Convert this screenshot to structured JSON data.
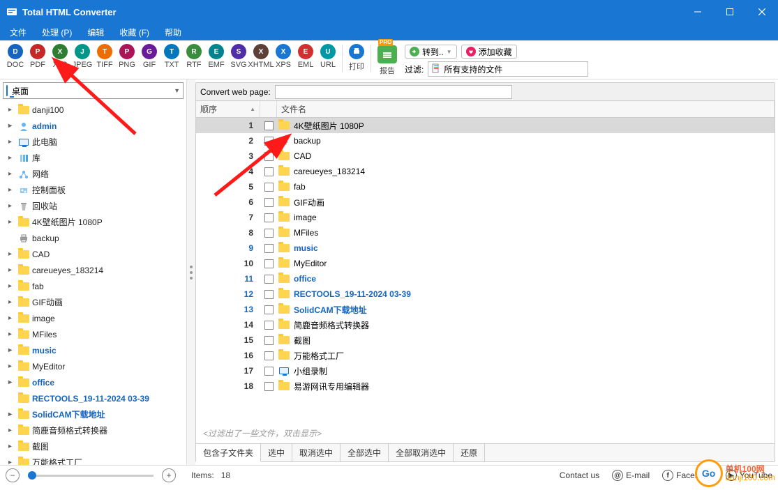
{
  "title": "Total HTML Converter",
  "menubar": [
    "文件",
    "处理 (P)",
    "编辑",
    "收藏 (F)",
    "帮助"
  ],
  "toolbar": {
    "formats": [
      {
        "label": "DOC",
        "color": "#1565C0"
      },
      {
        "label": "PDF",
        "color": "#C62828"
      },
      {
        "label": "XLS",
        "color": "#2E7D32"
      },
      {
        "label": "JPEG",
        "color": "#009688"
      },
      {
        "label": "TIFF",
        "color": "#EF6C00"
      },
      {
        "label": "PNG",
        "color": "#AD1457"
      },
      {
        "label": "GIF",
        "color": "#6A1B9A"
      },
      {
        "label": "TXT",
        "color": "#0277BD"
      },
      {
        "label": "RTF",
        "color": "#388E3C"
      },
      {
        "label": "EMF",
        "color": "#00838F"
      },
      {
        "label": "SVG",
        "color": "#512DA8"
      },
      {
        "label": "XHTML",
        "color": "#5D4037"
      },
      {
        "label": "XPS",
        "color": "#1976D2"
      },
      {
        "label": "EML",
        "color": "#D32F2F"
      },
      {
        "label": "URL",
        "color": "#0097A7"
      }
    ],
    "print": "打印",
    "report": {
      "badge": "PRO",
      "label": "报告"
    },
    "goto": "转到..",
    "addfav": "添加收藏",
    "filter_label": "过滤:",
    "filter_value": "所有支持的文件"
  },
  "tree": {
    "root": "桌面",
    "items": [
      {
        "label": "danji100",
        "type": "folder",
        "exp": true,
        "bold": false
      },
      {
        "label": "admin",
        "type": "user",
        "exp": true,
        "bold": true
      },
      {
        "label": "此电脑",
        "type": "pc",
        "exp": true,
        "bold": false
      },
      {
        "label": "库",
        "type": "lib",
        "exp": true,
        "bold": false
      },
      {
        "label": "网络",
        "type": "net",
        "exp": true,
        "bold": false
      },
      {
        "label": "控制面板",
        "type": "cpanel",
        "exp": true,
        "bold": false
      },
      {
        "label": "回收站",
        "type": "bin",
        "exp": true,
        "bold": false
      },
      {
        "label": "4K壁纸图片 1080P",
        "type": "folder",
        "exp": true,
        "bold": false
      },
      {
        "label": "backup",
        "type": "printer",
        "exp": false,
        "bold": false
      },
      {
        "label": "CAD",
        "type": "folder",
        "exp": true,
        "bold": false
      },
      {
        "label": "careueyes_183214",
        "type": "folder",
        "exp": true,
        "bold": false
      },
      {
        "label": "fab",
        "type": "folder",
        "exp": true,
        "bold": false
      },
      {
        "label": "GIF动画",
        "type": "folder",
        "exp": true,
        "bold": false
      },
      {
        "label": "image",
        "type": "folder",
        "exp": true,
        "bold": false
      },
      {
        "label": "MFiles",
        "type": "folder",
        "exp": true,
        "bold": false
      },
      {
        "label": "music",
        "type": "folder",
        "exp": true,
        "bold": true
      },
      {
        "label": "MyEditor",
        "type": "folder",
        "exp": true,
        "bold": false
      },
      {
        "label": "office",
        "type": "folder",
        "exp": true,
        "bold": true
      },
      {
        "label": "RECTOOLS_19-11-2024 03-39",
        "type": "folder",
        "exp": false,
        "bold": true
      },
      {
        "label": "SolidCAM下载地址",
        "type": "folder",
        "exp": true,
        "bold": true
      },
      {
        "label": "简鹿音频格式转换器",
        "type": "folder",
        "exp": true,
        "bold": false
      },
      {
        "label": "截图",
        "type": "folder",
        "exp": true,
        "bold": false
      },
      {
        "label": "万能格式工厂",
        "type": "folder",
        "exp": true,
        "bold": false
      }
    ]
  },
  "panel": {
    "convert_label": "Convert web page:",
    "convert_value": "",
    "headers": {
      "order": "顺序",
      "filename": "文件名"
    },
    "rows": [
      {
        "idx": 1,
        "name": "4K壁纸图片 1080P",
        "type": "folder",
        "blue": false,
        "sel": true
      },
      {
        "idx": 2,
        "name": "backup",
        "type": "printer",
        "blue": false
      },
      {
        "idx": 3,
        "name": "CAD",
        "type": "folder",
        "blue": false
      },
      {
        "idx": 4,
        "name": "careueyes_183214",
        "type": "folder",
        "blue": false
      },
      {
        "idx": 5,
        "name": "fab",
        "type": "folder",
        "blue": false
      },
      {
        "idx": 6,
        "name": "GIF动画",
        "type": "folder",
        "blue": false
      },
      {
        "idx": 7,
        "name": "image",
        "type": "folder",
        "blue": false
      },
      {
        "idx": 8,
        "name": "MFiles",
        "type": "folder",
        "blue": false
      },
      {
        "idx": 9,
        "name": "music",
        "type": "folder",
        "blue": true
      },
      {
        "idx": 10,
        "name": "MyEditor",
        "type": "folder",
        "blue": false
      },
      {
        "idx": 11,
        "name": "office",
        "type": "folder",
        "blue": true
      },
      {
        "idx": 12,
        "name": "RECTOOLS_19-11-2024 03-39",
        "type": "folder",
        "blue": true
      },
      {
        "idx": 13,
        "name": "SolidCAM下载地址",
        "type": "folder",
        "blue": true
      },
      {
        "idx": 14,
        "name": "简鹿音频格式转换器",
        "type": "folder",
        "blue": false
      },
      {
        "idx": 15,
        "name": "截图",
        "type": "folder",
        "blue": false
      },
      {
        "idx": 16,
        "name": "万能格式工厂",
        "type": "folder",
        "blue": false
      },
      {
        "idx": 17,
        "name": "小组录制",
        "type": "monitor",
        "blue": false
      },
      {
        "idx": 18,
        "name": "易游网讯专用编辑器",
        "type": "folder",
        "blue": false
      }
    ],
    "filter_note": "<过滤出了一些文件，双击显示>",
    "bottombar": [
      "包含子文件夹",
      "选中",
      "取消选中",
      "全部选中",
      "全部取消选中",
      "还原"
    ]
  },
  "footer": {
    "items_label": "Items:",
    "items_count": "18",
    "contact": "Contact us",
    "email": "E-mail",
    "facebook": "Facebook",
    "youtube": "YouTube"
  },
  "watermark": {
    "t1": "单机100网",
    "t2": "danji100.com"
  }
}
